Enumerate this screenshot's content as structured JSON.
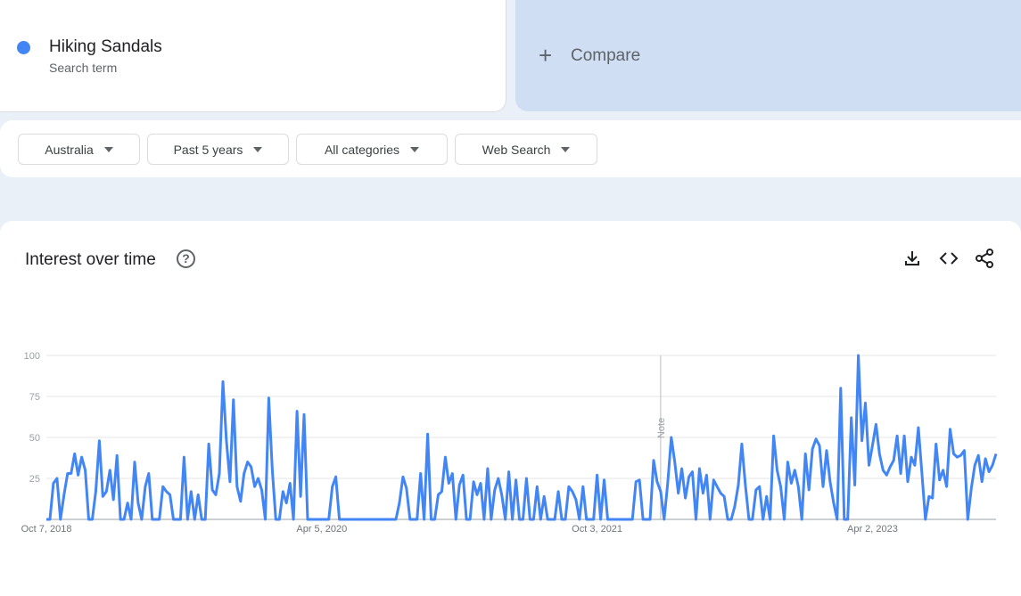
{
  "search_term": {
    "name": "Hiking Sandals",
    "subtitle": "Search term",
    "color": "#4285f4"
  },
  "compare": {
    "label": "Compare",
    "icon": "plus-icon"
  },
  "filters": {
    "region": "Australia",
    "period": "Past 5 years",
    "category": "All categories",
    "search_type": "Web Search"
  },
  "panel": {
    "title": "Interest over time",
    "icons": [
      "help-icon",
      "download-icon",
      "embed-code-icon",
      "share-icon"
    ]
  },
  "chart_data": {
    "type": "line",
    "title": "Interest over time",
    "series": [
      {
        "name": "Hiking Sandals",
        "color": "#4285f4",
        "values": [
          0,
          0,
          22,
          25,
          0,
          15,
          28,
          28,
          40,
          27,
          38,
          30,
          0,
          0,
          17,
          48,
          14,
          17,
          30,
          12,
          39,
          0,
          0,
          10,
          0,
          35,
          10,
          0,
          20,
          28,
          0,
          0,
          0,
          20,
          17,
          15,
          0,
          0,
          0,
          38,
          0,
          17,
          0,
          15,
          0,
          0,
          46,
          18,
          15,
          28,
          84,
          48,
          23,
          73,
          20,
          11,
          28,
          35,
          32,
          20,
          25,
          18,
          0,
          74,
          30,
          0,
          0,
          17,
          10,
          22,
          0,
          66,
          14,
          64,
          0,
          0,
          0,
          0,
          0,
          0,
          0,
          20,
          26,
          0,
          0,
          0,
          0,
          0,
          0,
          0,
          0,
          0,
          0,
          0,
          0,
          0,
          0,
          0,
          0,
          0,
          10,
          26,
          19,
          0,
          0,
          0,
          28,
          0,
          52,
          0,
          0,
          15,
          17,
          38,
          22,
          28,
          0,
          21,
          27,
          0,
          0,
          23,
          15,
          22,
          0,
          31,
          0,
          18,
          25,
          15,
          0,
          29,
          0,
          24,
          0,
          0,
          25,
          0,
          0,
          20,
          0,
          14,
          0,
          0,
          0,
          17,
          0,
          0,
          20,
          17,
          12,
          0,
          20,
          0,
          0,
          0,
          27,
          0,
          24,
          0,
          0,
          0,
          0,
          0,
          0,
          0,
          0,
          23,
          24,
          0,
          0,
          0,
          36,
          23,
          17,
          0,
          22,
          50,
          35,
          16,
          31,
          13,
          26,
          29,
          0,
          31,
          16,
          27,
          0,
          24,
          20,
          16,
          14,
          0,
          0,
          8,
          21,
          46,
          21,
          0,
          0,
          18,
          20,
          0,
          14,
          0,
          51,
          30,
          20,
          0,
          35,
          22,
          30,
          20,
          0,
          40,
          18,
          43,
          49,
          45,
          20,
          42,
          23,
          10,
          0,
          80,
          0,
          0,
          62,
          21,
          100,
          48,
          71,
          33,
          45,
          58,
          40,
          30,
          27,
          32,
          36,
          51,
          28,
          51,
          23,
          38,
          33,
          56,
          28,
          0,
          14,
          13,
          46,
          24,
          30,
          20,
          55,
          40,
          38,
          39,
          42,
          0,
          19,
          33,
          39,
          23,
          37,
          29,
          33,
          40
        ],
        "max": 100
      }
    ],
    "y_ticks": [
      100,
      75,
      50,
      25
    ],
    "ylim": [
      0,
      100
    ],
    "x_tick_labels": [
      "Oct 7, 2018",
      "Apr 5, 2020",
      "Oct 3, 2021",
      "Apr 2, 2023"
    ],
    "annotation": {
      "label": "Note",
      "at_x_label": "Oct 3, 2021"
    },
    "grid": true
  }
}
